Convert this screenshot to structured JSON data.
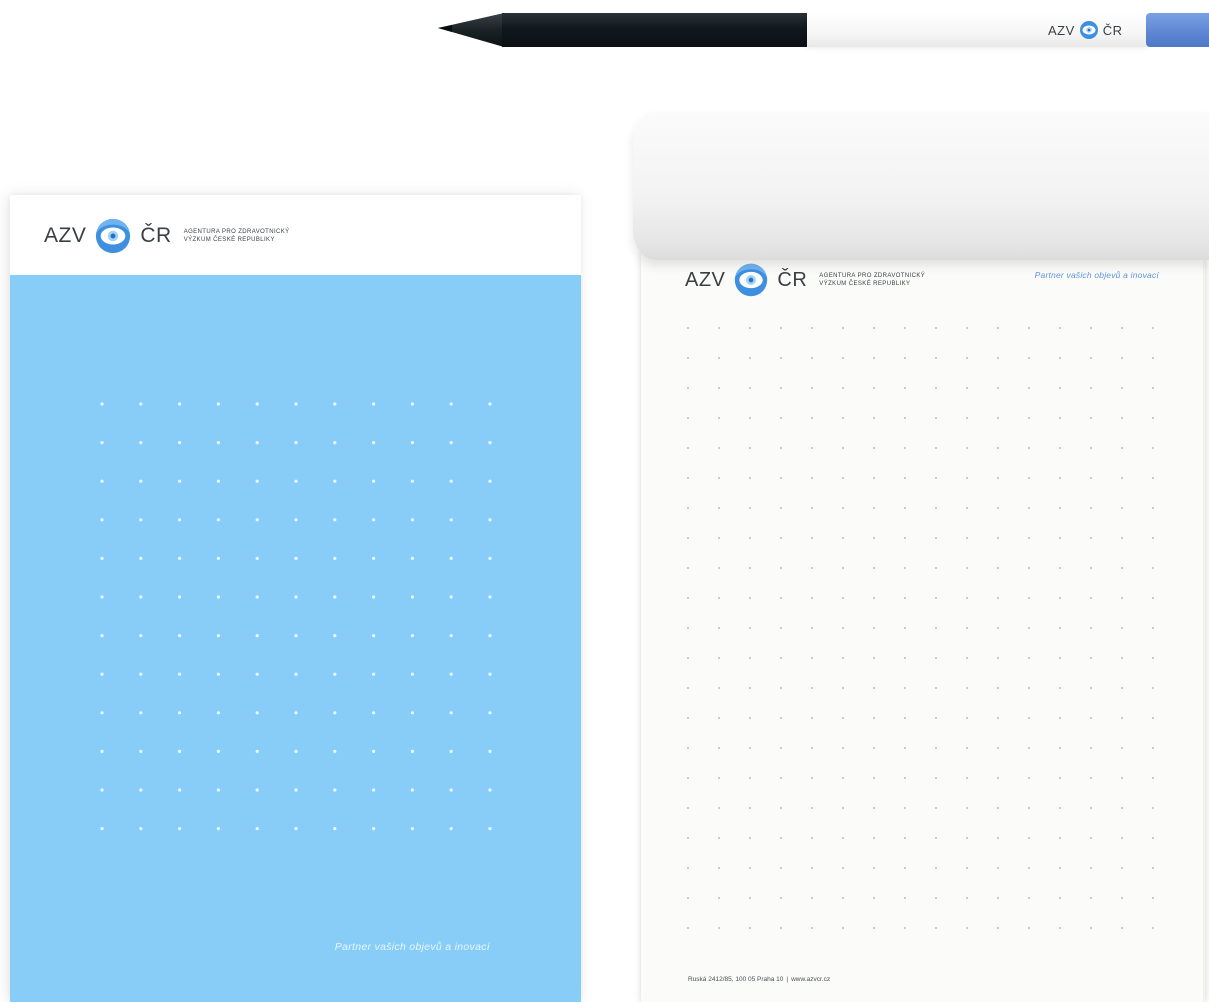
{
  "brand": {
    "logo_left": "AZV",
    "logo_right": "ČR",
    "agency_line1": "AGENTURA PRO ZDRAVOTNICKÝ",
    "agency_line2": "VÝZKUM ČESKÉ REPUBLIKY",
    "tagline": "Partner vašich objevů a inovací",
    "colors": {
      "pad_blue": "#88cdf8",
      "logo_blue": "#3f8fe0",
      "logo_light_blue": "#9fd4fb",
      "tagline_blue": "#5f95d6",
      "pencil_blue": "#5c86d4",
      "pencil_dark": "#11181d"
    }
  },
  "pencil": {
    "logo_left": "AZV",
    "logo_right": "ČR",
    "icon": "eye-icon"
  },
  "blue_notepad": {
    "logo_left": "AZV",
    "logo_right": "ČR",
    "agency_line1": "AGENTURA PRO ZDRAVOTNICKÝ",
    "agency_line2": "VÝZKUM ČESKÉ REPUBLIKY",
    "tagline": "Partner vašich objevů a inovací",
    "icon": "eye-icon"
  },
  "white_notepad": {
    "logo_left": "AZV",
    "logo_right": "ČR",
    "agency_line1": "AGENTURA PRO ZDRAVOTNICKÝ",
    "agency_line2": "VÝZKUM ČESKÉ REPUBLIKY",
    "tagline": "Partner vašich objevů a inovací",
    "address": "Ruská 2412/85, 100 05 Praha 10",
    "separator": "|",
    "website": "www.azvcr.cz",
    "icon": "eye-icon"
  }
}
